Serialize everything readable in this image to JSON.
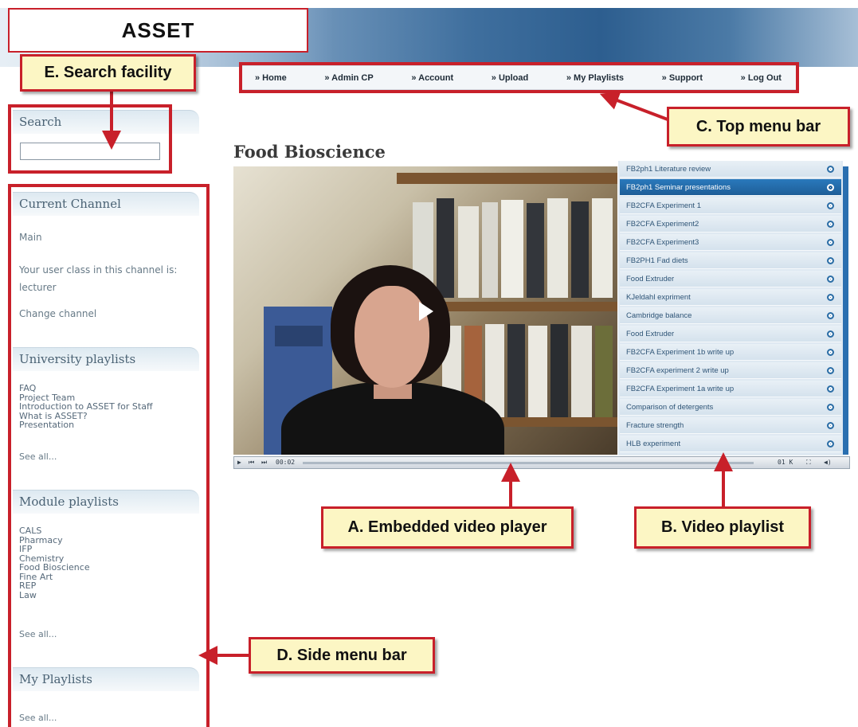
{
  "header": {
    "title": "ASSET"
  },
  "top_menu": {
    "items": [
      "» Home",
      "» Admin CP",
      "» Account",
      "» Upload",
      "» My Playlists",
      "» Support",
      "» Log Out"
    ]
  },
  "search": {
    "heading": "Search",
    "value": ""
  },
  "current_channel": {
    "heading": "Current Channel",
    "channel": "Main",
    "user_class_line1": "Your user class in this channel is:",
    "user_class_line2": "lecturer",
    "change_channel": "Change channel"
  },
  "university_playlists": {
    "heading": "University playlists",
    "items": [
      "FAQ",
      "Project Team",
      "Introduction to ASSET for Staff",
      "What is ASSET?",
      "Presentation"
    ],
    "see_all": "See all..."
  },
  "module_playlists": {
    "heading": "Module playlists",
    "items": [
      "CALS",
      "Pharmacy",
      "IFP",
      "Chemistry",
      "Food Bioscience",
      "Fine Art",
      "REP",
      "Law"
    ],
    "see_all": "See all..."
  },
  "my_playlists": {
    "heading": "My Playlists",
    "see_all": "See all..."
  },
  "main": {
    "title": "Food Bioscience"
  },
  "player": {
    "time": "00:02",
    "right_label": "01 K"
  },
  "playlist": {
    "selected_index": 1,
    "items": [
      "FB2ph1 Literature review",
      "FB2ph1 Seminar presentations",
      "FB2CFA Experiment 1",
      "FB2CFA Experiment2",
      "FB2CFA Experiment3",
      "FB2PH1 Fad diets",
      "Food Extruder",
      "KJeldahl expriment",
      "Cambridge balance",
      "Food Extruder",
      "FB2CFA Experiment 1b write up",
      "FB2CFA experiment 2 write up",
      "FB2CFA Experiment 1a write up",
      "Comparison of detergents",
      "Fracture strength",
      "HLB experiment"
    ]
  },
  "callouts": {
    "a": "A. Embedded video player",
    "b": "B. Video playlist",
    "c": "C. Top menu bar",
    "d": "D. Side menu bar",
    "e": "E. Search facility"
  },
  "colors": {
    "annotation_red": "#c8202a",
    "callout_fill": "#fcf6c4",
    "selected_row": "#1e5e98"
  }
}
